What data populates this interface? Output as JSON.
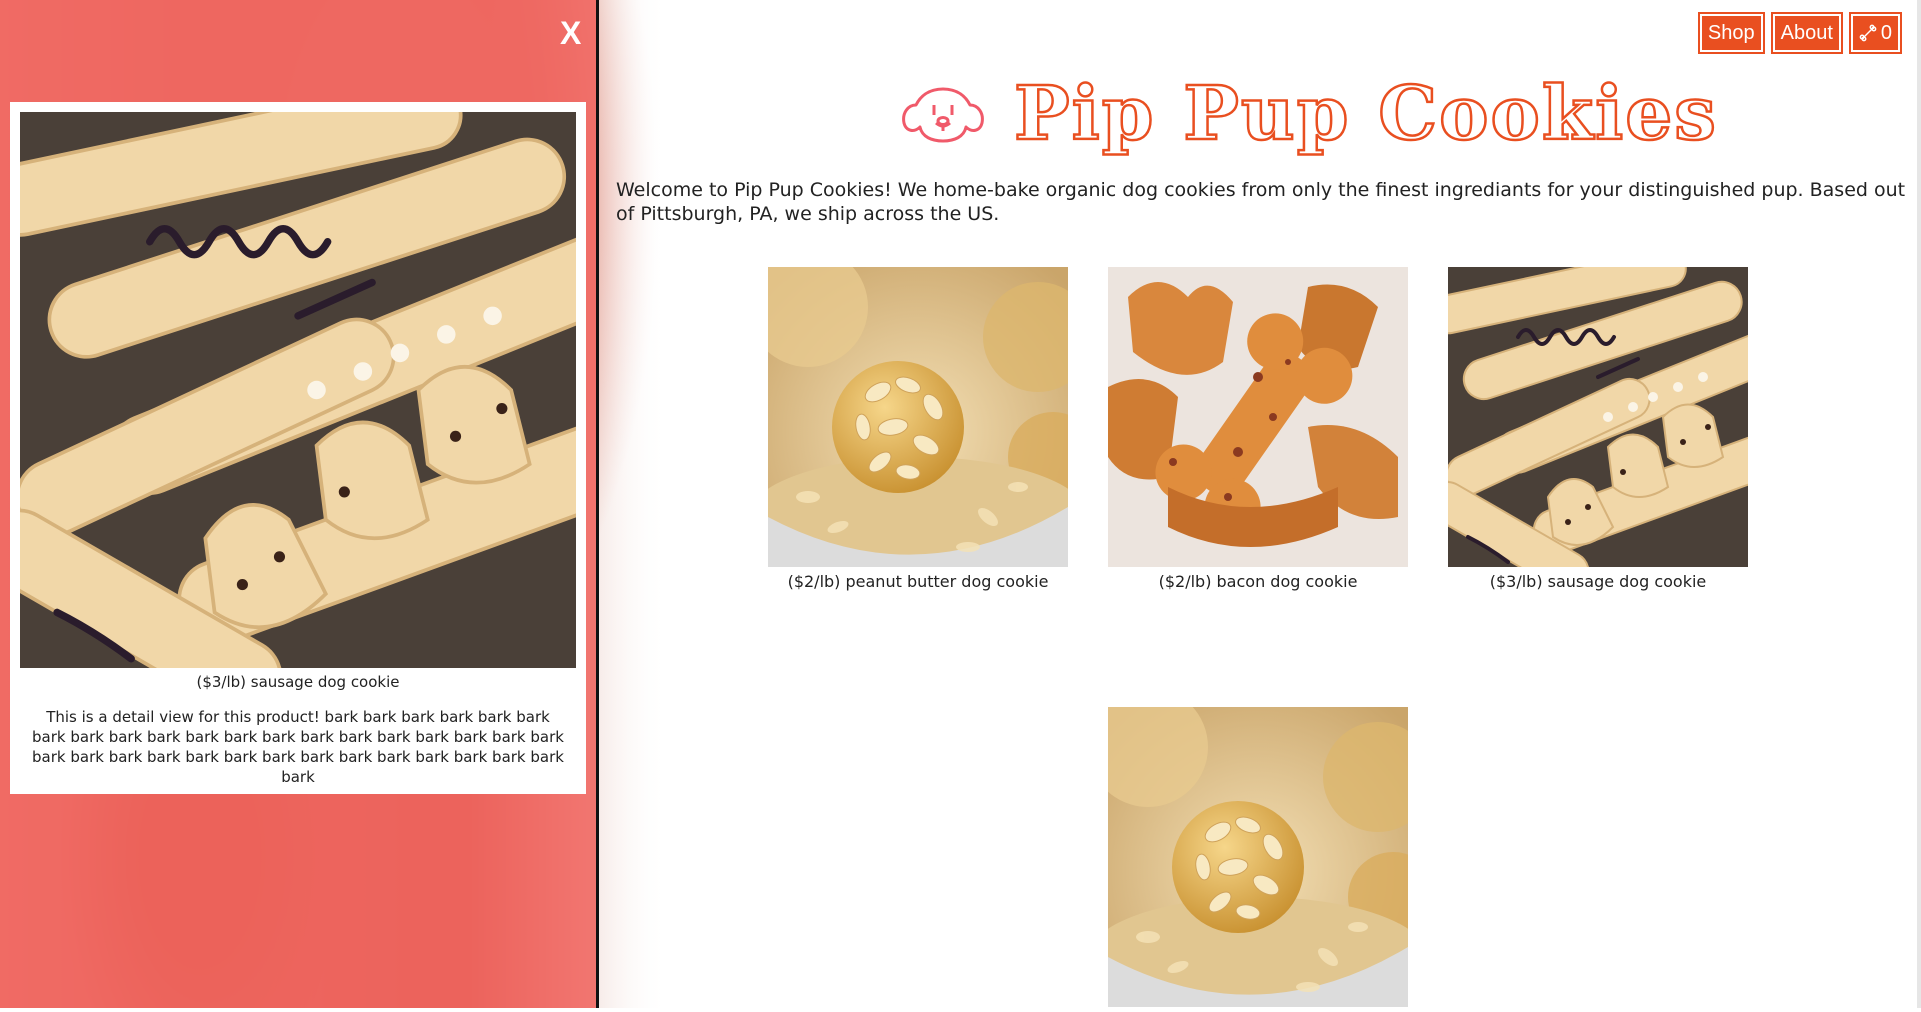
{
  "overlay": {
    "close_label": "X",
    "caption": "($3/lb) sausage dog cookie",
    "description": "This is a detail view for this product! bark bark bark bark bark bark bark bark bark bark bark bark bark bark bark bark bark bark bark bark bark bark bark bark bark bark bark bark bark bark bark bark bark bark bark"
  },
  "nav": {
    "shop_label": "Shop",
    "about_label": "About",
    "cart_count": "0"
  },
  "header": {
    "title": "Pip Pup Cookies",
    "intro": "Welcome to Pip Pup Cookies! We home-bake organic dog cookies from only the finest ingrediants for your distinguished pup. Based out of Pittsburgh, PA, we ship across the US."
  },
  "products": [
    {
      "caption": "($2/lb) peanut butter dog cookie",
      "image": "oat-ball"
    },
    {
      "caption": "($2/lb) bacon dog cookie",
      "image": "bone-biscuit"
    },
    {
      "caption": "($3/lb) sausage dog cookie",
      "image": "sausage-dogs"
    },
    {
      "caption": "",
      "image": "oat-ball"
    }
  ],
  "colors": {
    "accent": "#e94f20",
    "overlay": "#f0645f",
    "logo": "#f05a6a"
  }
}
